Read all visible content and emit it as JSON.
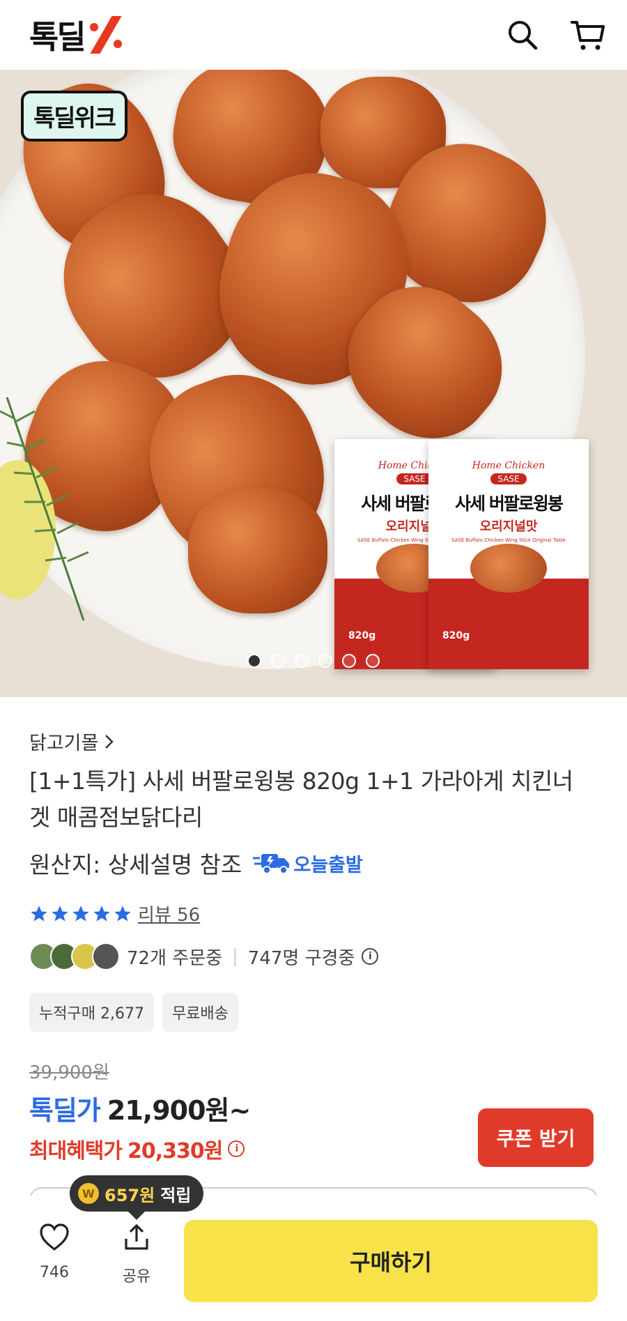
{
  "header": {
    "logo_text": "톡딜",
    "logo_mark": "%"
  },
  "hero": {
    "badge": "톡딜위크",
    "package": {
      "brand": "Home Chicken",
      "sub_brand": "SASE",
      "product_name": "사세 버팔로윙봉",
      "flavor": "오리지널맛",
      "english": "SASE Buffalo Chicken Wing Stick Original Taste",
      "weight": "820g"
    },
    "pagination": {
      "total": 6,
      "active": 0
    }
  },
  "product": {
    "store": "닭고기몰",
    "title": "[1+1특가] 사세 버팔로윙봉 820g 1+1 가라아게 치킨너겟 매콤점보닭다리",
    "origin": "원산지: 상세설명 참조",
    "shipping": "오늘출발",
    "rating_stars": 5,
    "review_label": "리뷰 56",
    "orders": "72개 주문중",
    "viewers": "747명 구경중",
    "tags": [
      "누적구매 2,677",
      "무료배송"
    ],
    "original_price": "39,900원",
    "deal_label": "톡딜가",
    "deal_price": "21,900원~",
    "max_benefit_label": "최대혜택가",
    "max_benefit_price": "20,330원",
    "coupon_button": "쿠폰 받기"
  },
  "bottom": {
    "points_amount": "657원",
    "points_label": "적립",
    "like_count": "746",
    "share_label": "공유",
    "buy_button": "구매하기"
  },
  "colors": {
    "brand_red": "#e8381f",
    "accent_blue": "#2b6be3",
    "coupon_red": "#e03b2a",
    "buy_yellow": "#f8e24a"
  }
}
